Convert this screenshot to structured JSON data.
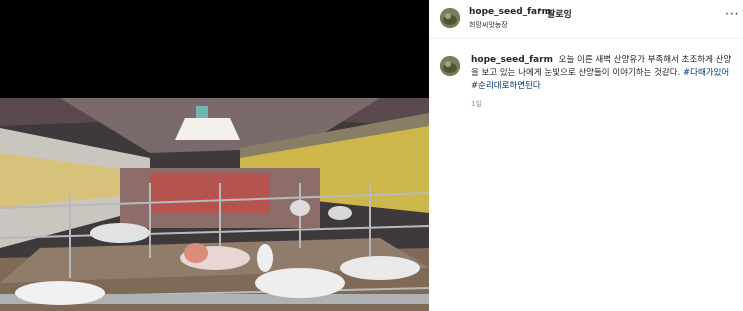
{
  "post": {
    "username": "hope_seed_farm",
    "separator": "•",
    "follow_label": "팔로잉",
    "location": "희망씨앗농장",
    "more_icon": "more-options-icon",
    "image_alt": "barn with goats at night",
    "caption": {
      "username": "hope_seed_farm",
      "text": "오늘 이른 새벽 산양유가 부족해서 초조하게 산양을 보고 있는 나에게 눈빛으로 산양들이 이야기하는 것같다.",
      "hashtag_1": "#다때가있어",
      "hashtag_2": "#순리대로하면된다"
    },
    "time_ago": "1일"
  }
}
